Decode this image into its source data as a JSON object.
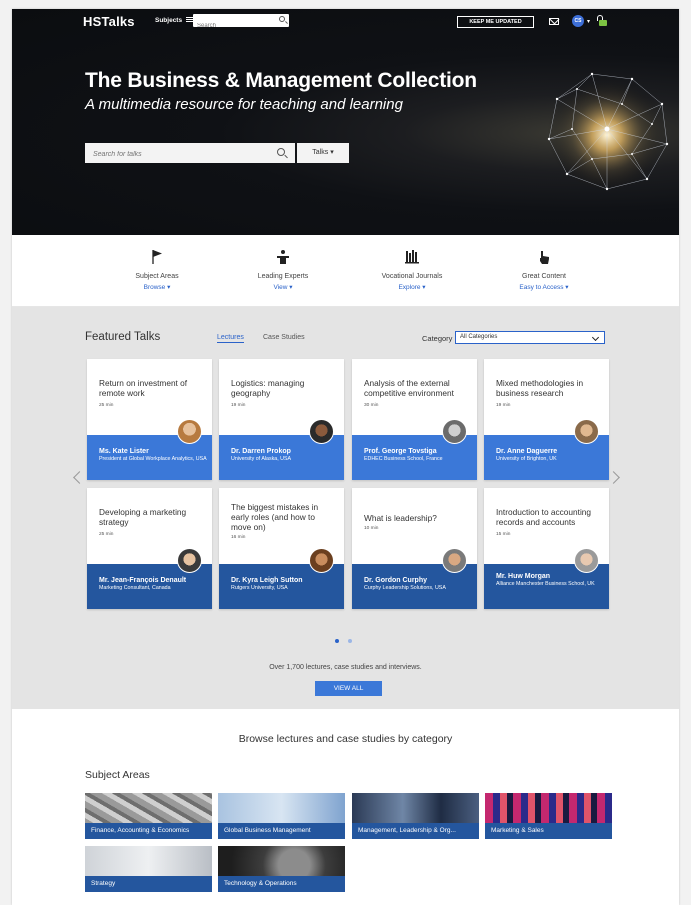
{
  "header": {
    "logo": "HSTalks",
    "subjects_label": "Subjects",
    "search_placeholder": "Search",
    "keep_updated": "KEEP ME UPDATED",
    "avatar_initials": "CS"
  },
  "hero": {
    "title": "The Business & Management Collection",
    "subtitle": "A multimedia resource for teaching and learning",
    "search_placeholder": "Search for talks",
    "talks_dropdown": "Talks"
  },
  "features": [
    {
      "icon": "flag-icon",
      "title": "Subject Areas",
      "link": "Browse"
    },
    {
      "icon": "podium-icon",
      "title": "Leading Experts",
      "link": "View"
    },
    {
      "icon": "journals-icon",
      "title": "Vocational Journals",
      "link": "Explore"
    },
    {
      "icon": "pointer-icon",
      "title": "Great Content",
      "link": "Easy to Access"
    }
  ],
  "featured": {
    "title": "Featured Talks",
    "tabs": [
      "Lectures",
      "Case Studies"
    ],
    "active_tab": "Lectures",
    "category_label": "Category",
    "category_value": "All Categories",
    "cards": [
      {
        "title": "Return on investment of remote work",
        "duration": "25 min",
        "speaker": "Ms. Kate Lister",
        "affiliation": "President at Global Workplace Analytics, USA"
      },
      {
        "title": "Logistics: managing geography",
        "duration": "19 min",
        "speaker": "Dr. Darren Prokop",
        "affiliation": "University of Alaska, USA"
      },
      {
        "title": "Analysis of the external competitive environment",
        "duration": "30 min",
        "speaker": "Prof. George Tovstiga",
        "affiliation": "EDHEC Business School, France"
      },
      {
        "title": "Mixed methodologies in business research",
        "duration": "19 min",
        "speaker": "Dr. Anne Daguerre",
        "affiliation": "University of Brighton, UK"
      },
      {
        "title": "Developing a marketing strategy",
        "duration": "25 min",
        "speaker": "Mr. Jean-François Denault",
        "affiliation": "Marketing Consultant, Canada"
      },
      {
        "title": "The biggest mistakes in early roles (and how to move on)",
        "duration": "16 min",
        "speaker": "Dr. Kyra Leigh Sutton",
        "affiliation": "Rutgers University, USA"
      },
      {
        "title": "What is leadership?",
        "duration": "10 min",
        "speaker": "Dr. Gordon Curphy",
        "affiliation": "Curphy Leadership Solutions, USA"
      },
      {
        "title": "Introduction to accounting records and accounts",
        "duration": "15 min",
        "speaker": "Mr. Huw Morgan",
        "affiliation": "Alliance Manchester Business School, UK"
      }
    ],
    "summary": "Over 1,700 lectures, case studies and interviews.",
    "view_all": "VIEW ALL"
  },
  "browse": {
    "title": "Browse lectures and case studies by category",
    "subject_areas_title": "Subject Areas",
    "tiles": [
      "Finance, Accounting & Economics",
      "Global Business Management",
      "Management, Leadership & Org...",
      "Marketing & Sales",
      "Strategy",
      "Technology & Operations"
    ]
  },
  "colors": {
    "accent": "#3b78d8",
    "band_dark": "#24569e",
    "link": "#2a62c9"
  }
}
